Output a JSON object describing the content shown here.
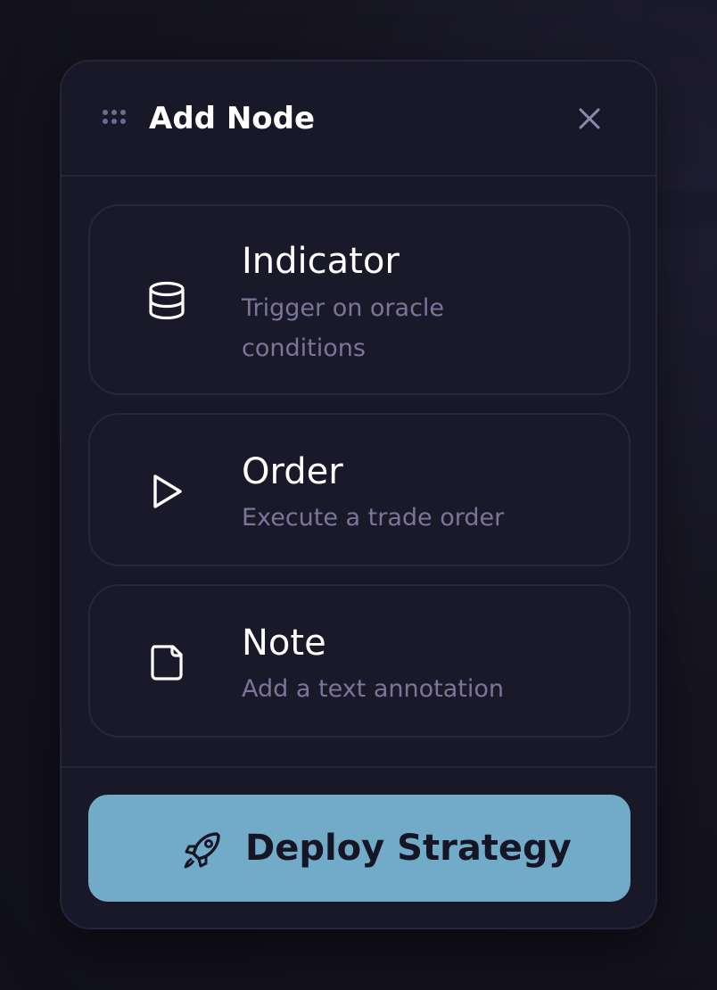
{
  "panel": {
    "title": "Add Node",
    "drag_handle_icon": "grip-dots-icon",
    "close_icon": "close-icon"
  },
  "nodes": [
    {
      "title": "Indicator",
      "description": "Trigger on oracle conditions",
      "icon": "database-icon"
    },
    {
      "title": "Order",
      "description": "Execute a trade order",
      "icon": "play-icon"
    },
    {
      "title": "Note",
      "description": "Add a text annotation",
      "icon": "note-icon"
    }
  ],
  "footer": {
    "deploy_label": "Deploy Strategy",
    "deploy_icon": "rocket-icon"
  },
  "colors": {
    "panel_bg": "#191829",
    "accent": "#72abc7",
    "muted_text": "#7a7599",
    "title_text": "#ffffff"
  }
}
